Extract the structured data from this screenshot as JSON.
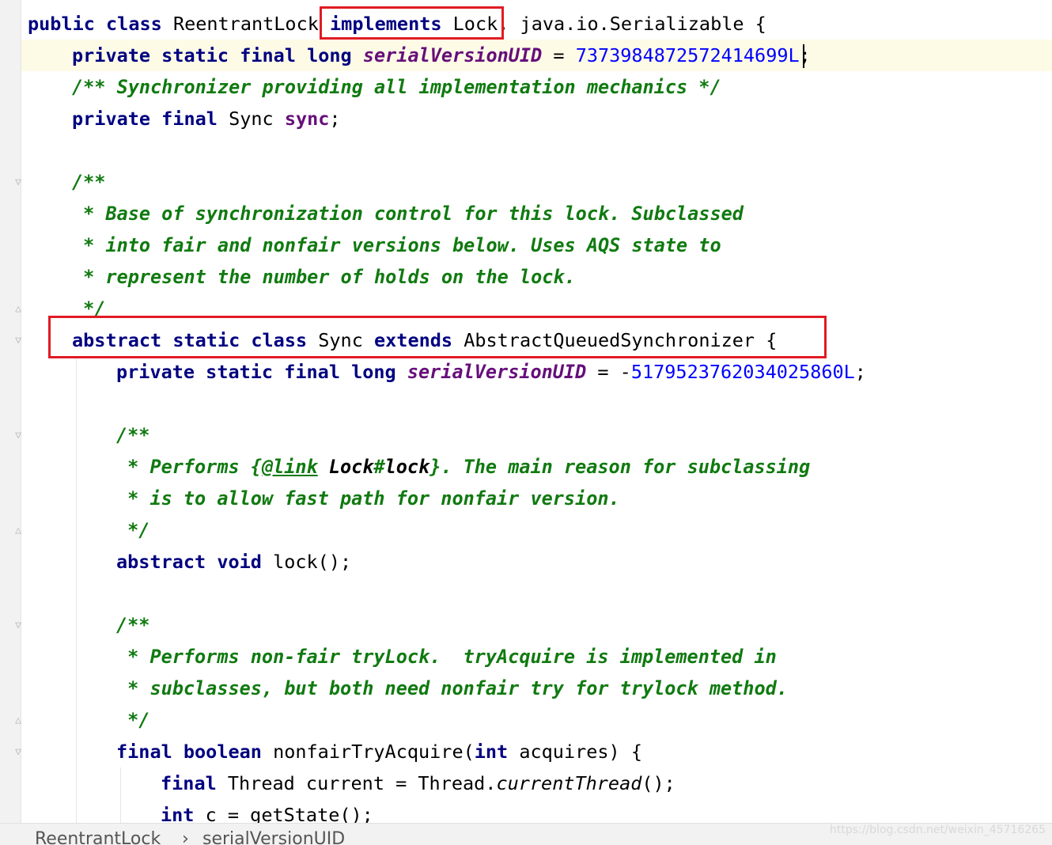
{
  "code": {
    "l1": {
      "kw1": "public class ",
      "name": "ReentrantLock",
      "kw2": "implements",
      "iface": " Lock,",
      "rest": " java.io.Serializable {"
    },
    "l2": {
      "kw": "private static final long ",
      "field": "serialVersionUID",
      "eq": " = ",
      "val": "7373984872572414699L",
      "semi": ";"
    },
    "l3": {
      "comment": "/** Synchronizer providing all implementation mechanics */"
    },
    "l4": {
      "kw": "private final ",
      "type": "Sync ",
      "field": "sync",
      "semi": ";"
    },
    "l6": {
      "comment": "/**"
    },
    "l7": {
      "comment": " * Base of synchronization control for this lock. Subclassed"
    },
    "l8": {
      "comment": " * into fair and nonfair versions below. Uses AQS state to"
    },
    "l9": {
      "comment": " * represent the number of holds on the lock."
    },
    "l10": {
      "comment": " */"
    },
    "l11": {
      "kw1": "abstract static class ",
      "name": "Sync ",
      "kw2": "extends",
      "rest": " AbstractQueuedSynchronizer {"
    },
    "l12": {
      "kw": "private static final long ",
      "field": "serialVersionUID",
      "eq": " = -",
      "val": "5179523762034025860L",
      "semi": ";"
    },
    "l14": {
      "comment": "/**"
    },
    "l15": {
      "c1": " * Performs {",
      "tag": "@link",
      "sp": " ",
      "ref1": "Lock",
      "hash": "#",
      "ref2": "lock",
      "c2": "}. The main reason for subclassing"
    },
    "l16": {
      "comment": " * is to allow fast path for nonfair version."
    },
    "l17": {
      "comment": " */"
    },
    "l18": {
      "kw": "abstract void ",
      "rest": "lock();"
    },
    "l20": {
      "comment": "/**"
    },
    "l21": {
      "comment": " * Performs non-fair tryLock.  tryAcquire is implemented in"
    },
    "l22": {
      "comment": " * subclasses, but both need nonfair try for trylock method."
    },
    "l23": {
      "comment": " */"
    },
    "l24": {
      "kw1": "final boolean ",
      "m": "nonfairTryAcquire(",
      "kw2": "int",
      "rest": " acquires) {"
    },
    "l25": {
      "kw": "final ",
      "a": "Thread current = Thread.",
      "m": "currentThread",
      "b": "();"
    },
    "l26": {
      "kw": "int ",
      "rest": "c = getState();"
    }
  },
  "breadcrumb": {
    "item1": "ReentrantLock",
    "sep": "›",
    "item2": "serialVersionUID"
  },
  "watermark": "https://blog.csdn.net/weixin_45716265",
  "colors": {
    "keyword": "#000080",
    "field": "#660e7a",
    "number": "#0000ff",
    "comment": "#107a10",
    "highlight_box": "#e01b24"
  }
}
